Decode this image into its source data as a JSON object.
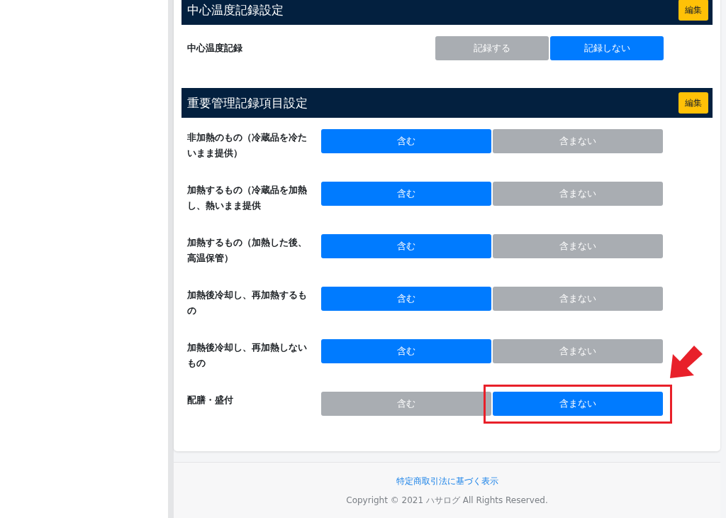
{
  "sections": [
    {
      "title": "中心温度記録設定",
      "edit_button": "編集",
      "kind": "single",
      "rows": [
        {
          "label": "中心温度記録",
          "highlighted": false,
          "options": [
            {
              "label": "記録する",
              "selected": false
            },
            {
              "label": "記録しない",
              "selected": true
            }
          ]
        }
      ]
    },
    {
      "title": "重要管理記録項目設定",
      "edit_button": "編集",
      "kind": "list",
      "rows": [
        {
          "label": "非加熱のもの（冷蔵品を冷たいまま提供）",
          "highlighted": false,
          "options": [
            {
              "label": "含む",
              "selected": true
            },
            {
              "label": "含まない",
              "selected": false
            }
          ]
        },
        {
          "label": "加熱するもの（冷蔵品を加熱し、熱いまま提供",
          "highlighted": false,
          "options": [
            {
              "label": "含む",
              "selected": true
            },
            {
              "label": "含まない",
              "selected": false
            }
          ]
        },
        {
          "label": "加熱するもの（加熱した後、高温保管）",
          "highlighted": false,
          "options": [
            {
              "label": "含む",
              "selected": true
            },
            {
              "label": "含まない",
              "selected": false
            }
          ]
        },
        {
          "label": "加熱後冷却し、再加熱するもの",
          "highlighted": false,
          "options": [
            {
              "label": "含む",
              "selected": true
            },
            {
              "label": "含まない",
              "selected": false
            }
          ]
        },
        {
          "label": "加熱後冷却し、再加熱しないもの",
          "highlighted": false,
          "options": [
            {
              "label": "含む",
              "selected": true
            },
            {
              "label": "含まない",
              "selected": false
            }
          ]
        },
        {
          "label": "配膳・盛付",
          "highlighted": true,
          "options": [
            {
              "label": "含む",
              "selected": false
            },
            {
              "label": "含まない",
              "selected": true
            }
          ]
        }
      ]
    }
  ],
  "footer": {
    "link": "特定商取引法に基づく表示",
    "copyright": "Copyright © 2021 ハサログ All Rights Reserved."
  }
}
